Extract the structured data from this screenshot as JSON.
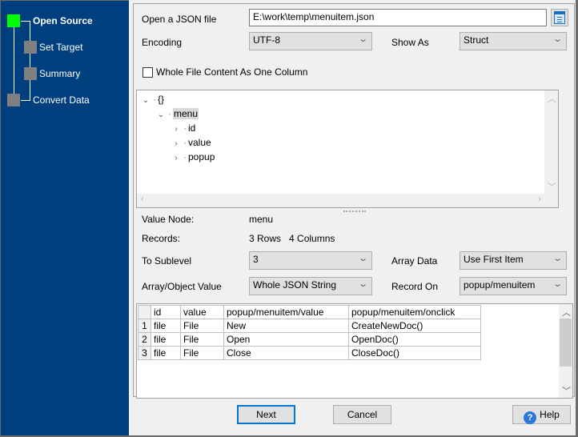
{
  "sidebar": {
    "steps": [
      {
        "label": "Open Source",
        "state": "active"
      },
      {
        "label": "Set Target",
        "state": "pending"
      },
      {
        "label": "Summary",
        "state": "pending"
      },
      {
        "label": "Convert Data",
        "state": "pending"
      }
    ],
    "colors": {
      "background": "#003f7d",
      "active": "#00ff00",
      "pending": "#808080"
    }
  },
  "source": {
    "file_label": "Open a JSON file",
    "file_value": "E:\\work\\temp\\menuitem.json",
    "browse_icon": "file-browse-icon",
    "encoding_label": "Encoding",
    "encoding_value": "UTF-8",
    "show_as_label": "Show As",
    "show_as_value": "Struct",
    "whole_file_label": "Whole File Content As One Column",
    "whole_file_checked": false
  },
  "tree": {
    "nodes": [
      {
        "label": "{}",
        "expanded": true,
        "level": 0
      },
      {
        "label": "menu",
        "expanded": true,
        "level": 1,
        "selected": true
      },
      {
        "label": "id",
        "expanded": false,
        "level": 2
      },
      {
        "label": "value",
        "expanded": false,
        "level": 2
      },
      {
        "label": "popup",
        "expanded": false,
        "level": 2
      }
    ]
  },
  "details": {
    "value_node_label": "Value Node:",
    "value_node_value": "menu",
    "records_label": "Records:",
    "records_value": "3 Rows   4 Columns",
    "sublevel_label": "To Sublevel",
    "sublevel_value": "3",
    "array_data_label": "Array Data",
    "array_data_value": "Use First Item",
    "array_object_label": "Array/Object Value",
    "array_object_value": "Whole JSON String",
    "record_on_label": "Record On",
    "record_on_value": "popup/menuitem"
  },
  "grid": {
    "columns": [
      "id",
      "value",
      "popup/menuitem/value",
      "popup/menuitem/onclick"
    ],
    "rows": [
      {
        "num": "1",
        "cells": [
          "file",
          "File",
          "New",
          "CreateNewDoc()"
        ]
      },
      {
        "num": "2",
        "cells": [
          "file",
          "File",
          "Open",
          "OpenDoc()"
        ]
      },
      {
        "num": "3",
        "cells": [
          "file",
          "File",
          "Close",
          "CloseDoc()"
        ]
      }
    ]
  },
  "buttons": {
    "next": "Next",
    "cancel": "Cancel",
    "help": "Help",
    "help_icon": "?"
  }
}
